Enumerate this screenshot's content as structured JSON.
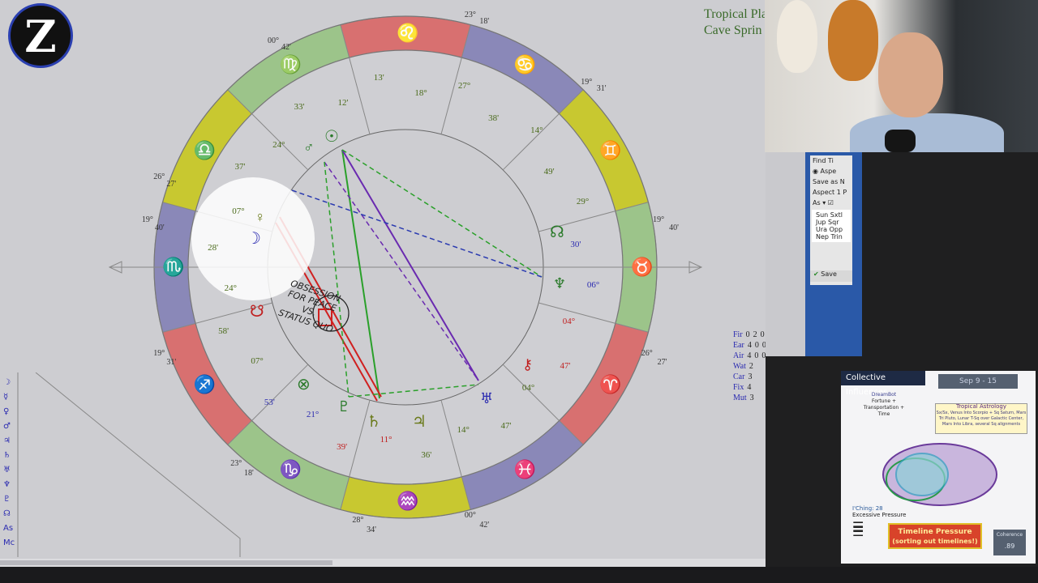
{
  "chart_window": {
    "title_lines": [
      "Tropical Pla",
      "Cave Sprin"
    ],
    "zodiac_signs": [
      "♌",
      "♋",
      "♊",
      "♉",
      "♈",
      "♓",
      "♒",
      "♑",
      "♐",
      "♏",
      "♎",
      "♍"
    ],
    "cusp_labels": [
      {
        "text": "23°",
        "pos": "top"
      },
      {
        "text": "18'",
        "pos": "top"
      },
      {
        "text": "19°",
        "pos": "upper-right"
      },
      {
        "text": "31'",
        "pos": "upper-right"
      },
      {
        "text": "19°",
        "pos": "right"
      },
      {
        "text": "40'",
        "pos": "right"
      },
      {
        "text": "26°",
        "pos": "lower-right"
      },
      {
        "text": "27'",
        "pos": "lower-right"
      },
      {
        "text": "00°",
        "pos": "bottom-right"
      },
      {
        "text": "42'",
        "pos": "bottom-right"
      },
      {
        "text": "28°",
        "pos": "bottom"
      },
      {
        "text": "34'",
        "pos": "bottom"
      },
      {
        "text": "23°",
        "pos": "bottom-left"
      },
      {
        "text": "18'",
        "pos": "bottom-left"
      },
      {
        "text": "19°",
        "pos": "lower-left"
      },
      {
        "text": "31'",
        "pos": "lower-left"
      },
      {
        "text": "19°",
        "pos": "left"
      },
      {
        "text": "40'",
        "pos": "left"
      },
      {
        "text": "26°",
        "pos": "upper-left"
      },
      {
        "text": "27'",
        "pos": "upper-left"
      },
      {
        "text": "00°",
        "pos": "top-left"
      },
      {
        "text": "42'",
        "pos": "top-left"
      }
    ],
    "planet_labels": [
      {
        "text": "12'",
        "color": "#4a6a1a"
      },
      {
        "text": "13'",
        "color": "#4a6a1a"
      },
      {
        "text": "18°",
        "color": "#4a6a1a"
      },
      {
        "text": "27°",
        "color": "#4a6a1a"
      },
      {
        "text": "38'",
        "color": "#4a6a1a"
      },
      {
        "text": "14°",
        "color": "#4a6a1a"
      },
      {
        "text": "49'",
        "color": "#4a6a1a"
      },
      {
        "text": "29°",
        "color": "#4a6a1a"
      },
      {
        "text": "30'",
        "color": "#2a2ab0"
      },
      {
        "text": "06°",
        "color": "#2a2ab0"
      },
      {
        "text": "04°",
        "color": "#c02020"
      },
      {
        "text": "47'",
        "color": "#c02020"
      },
      {
        "text": "04°",
        "color": "#4a6a1a"
      },
      {
        "text": "47'",
        "color": "#4a6a1a"
      },
      {
        "text": "14°",
        "color": "#4a6a1a"
      },
      {
        "text": "36'",
        "color": "#4a6a1a"
      },
      {
        "text": "11°",
        "color": "#c02020"
      },
      {
        "text": "39'",
        "color": "#c02020"
      },
      {
        "text": "21°",
        "color": "#2a2ab0"
      },
      {
        "text": "53'",
        "color": "#2a2ab0"
      },
      {
        "text": "07°",
        "color": "#4a6a1a"
      },
      {
        "text": "58'",
        "color": "#4a6a1a"
      },
      {
        "text": "24°",
        "color": "#4a6a1a"
      },
      {
        "text": "28'",
        "color": "#4a6a1a"
      },
      {
        "text": "07°",
        "color": "#4a6a1a"
      },
      {
        "text": "37'",
        "color": "#4a6a1a"
      },
      {
        "text": "24°",
        "color": "#4a6a1a"
      },
      {
        "text": "33'",
        "color": "#4a6a1a"
      }
    ],
    "annotation": [
      "OBSESSION",
      "FOR PEACE",
      "VS.",
      "STATUS QUO"
    ],
    "element_table": {
      "rows": [
        {
          "label": "Fir",
          "values": [
            "0",
            "2",
            "0"
          ]
        },
        {
          "label": "Ear",
          "values": [
            "4",
            "0",
            "0"
          ]
        },
        {
          "label": "Air",
          "values": [
            "4",
            "0",
            "0"
          ]
        },
        {
          "label": "Wat",
          "values": [
            "2",
            "",
            ""
          ]
        },
        {
          "label": "Car",
          "values": [
            "3",
            "",
            ""
          ]
        },
        {
          "label": "Fix",
          "values": [
            "4",
            "",
            ""
          ]
        },
        {
          "label": "Mut",
          "values": [
            "3",
            "",
            ""
          ]
        }
      ]
    },
    "aspect_grid_rows": [
      "☽",
      "☿",
      "♀",
      "♂",
      "♃",
      "♄",
      "♅",
      "♆",
      "♇",
      "☊",
      "As",
      "Mc"
    ]
  },
  "aspect_panel": {
    "find_label": "Find Ti",
    "radio_label": "Aspe",
    "save_as_label": "Save as N",
    "aspect_label": "Aspect 1 P",
    "select_value": "As",
    "list_items": [
      "Sun Sxtl",
      "Jup Sqr",
      "Ura Opp",
      "Nep Trin"
    ],
    "save_button": "Save"
  },
  "card": {
    "title": "Collective Influences",
    "date": "Sep 9 - 15",
    "dream_label": "DreamBot",
    "dream_text": [
      "Fortune +",
      "Transportation +",
      "Time"
    ],
    "tropical_title": "Tropical Astrology",
    "tropical_text": "Sx/Sx, Venus Into Scorpio + Sq Saturn, Mars Tri Pluto, Lunar T-Sq over Galactic Center, Mars Into Libra, several Sq alignments",
    "iching_label": "I'Ching: 28",
    "iching_text": "Excessive Pressure",
    "timeline_title": "Timeline Pressure",
    "timeline_sub": "(sorting out timelines!)",
    "coherence_label": "Coherence",
    "coherence_value": ".89"
  },
  "colors": {
    "green_band": "#9cc48a",
    "yellow_band": "#c8c830",
    "red_band": "#d87070",
    "blue_band": "#8a88b8",
    "panel_blue": "#2a59a8"
  }
}
